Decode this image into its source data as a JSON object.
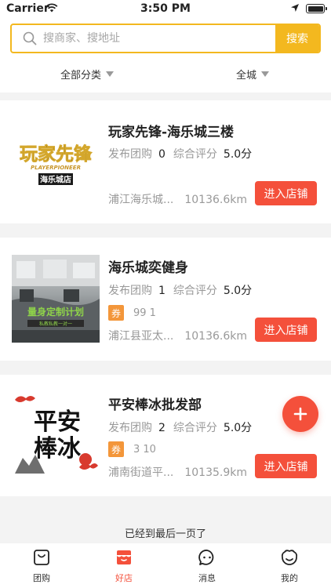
{
  "status_bar": {
    "carrier": "Carrier",
    "time": "3:50 PM"
  },
  "search": {
    "placeholder": "搜商家、搜地址",
    "button_label": "搜索"
  },
  "filters": {
    "category": "全部分类",
    "city": "全城"
  },
  "shops": [
    {
      "name": "玩家先锋-海乐城三楼",
      "published_label": "发布团购",
      "published_count": "0",
      "rating_label": "综合评分",
      "rating": "5.0分",
      "address": "浦江海乐城...",
      "distance": "10136.6km",
      "enter_label": "进入店铺",
      "logo_text_main": "玩家先锋",
      "logo_text_sub": "PLAYERPIONEER",
      "logo_text_badge": "海乐城店"
    },
    {
      "name": "海乐城奕健身",
      "published_label": "发布团购",
      "published_count": "1",
      "rating_label": "综合评分",
      "rating": "5.0分",
      "coupon_tag": "券",
      "coupon_text": "99 1",
      "address": "浦江县亚太...",
      "distance": "10136.6km",
      "enter_label": "进入店铺",
      "photo_text": "量身定制计划",
      "photo_subtext": "私教私教一对一"
    },
    {
      "name": "平安棒冰批发部",
      "published_label": "发布团购",
      "published_count": "2",
      "rating_label": "综合评分",
      "rating": "5.0分",
      "coupon_tag": "券",
      "coupon_text": "3 10",
      "address": "浦南街道平...",
      "distance": "10135.9km",
      "enter_label": "进入店铺",
      "logo_line1": "平安",
      "logo_line2": "棒冰"
    }
  ],
  "end_note": "已经到最后一页了",
  "tabs": [
    {
      "label": "团购",
      "icon": "bag-icon"
    },
    {
      "label": "好店",
      "icon": "shop-icon",
      "active": true
    },
    {
      "label": "消息",
      "icon": "chat-icon"
    },
    {
      "label": "我的",
      "icon": "face-icon"
    }
  ],
  "colors": {
    "accent": "#f3b81f",
    "primary": "#f4503b",
    "coupon": "#f3963a"
  }
}
